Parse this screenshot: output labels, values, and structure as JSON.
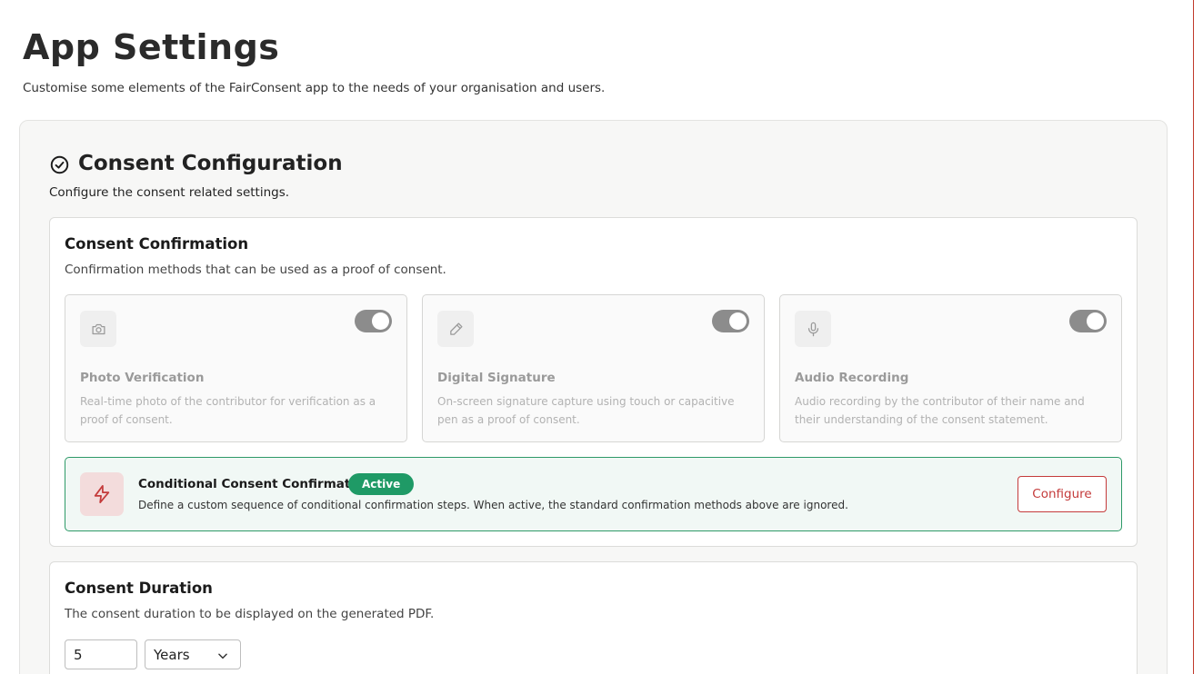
{
  "page": {
    "title": "App Settings",
    "subtitle": "Customise some elements of the FairConsent app to the needs of your organisation and users."
  },
  "consent_configuration": {
    "title": "Consent Configuration",
    "subtitle": "Configure the consent related settings.",
    "icon": "check-circle-icon",
    "confirmation": {
      "title": "Consent Confirmation",
      "subtitle": "Confirmation methods that can be used as a proof of consent.",
      "methods": [
        {
          "icon": "camera-icon",
          "title": "Photo Verification",
          "description": "Real-time photo of the contributor for verification as a proof of consent.",
          "enabled": true
        },
        {
          "icon": "pen-icon",
          "title": "Digital Signature",
          "description": "On-screen signature capture using touch or capacitive pen as a proof of consent.",
          "enabled": true
        },
        {
          "icon": "microphone-icon",
          "title": "Audio Recording",
          "description": "Audio recording by the contributor of their name and their understanding of the consent statement.",
          "enabled": true
        }
      ],
      "conditional": {
        "icon": "lightning-icon",
        "title": "Conditional Consent Confirmation",
        "badge": "Active",
        "description": "Define a custom sequence of conditional confirmation steps. When active, the standard confirmation methods above are ignored.",
        "button": "Configure"
      }
    },
    "duration": {
      "title": "Consent Duration",
      "subtitle": "The consent duration to be displayed on the generated PDF.",
      "value": "5",
      "unit": "Years"
    }
  },
  "colors": {
    "accent_red": "#c43b3b",
    "active_green": "#1f9a66",
    "toggle_gray": "#8c8c8c"
  }
}
